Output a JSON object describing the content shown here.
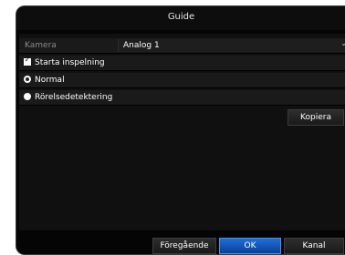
{
  "window": {
    "title": "Guide"
  },
  "form": {
    "camera_label": "Kamera",
    "camera_value": "Analog 1",
    "start_recording_label": "Starta inspelning",
    "start_recording_checked": true,
    "mode_options": [
      "Normal",
      "Rörelsedetektering"
    ],
    "mode_selected": "Normal",
    "copy_label": "Kopiera"
  },
  "footer": {
    "previous_label": "Föregående",
    "ok_label": "OK",
    "channel_label": "Kanal"
  },
  "colors": {
    "background": "#050505",
    "row": "#1a1a1a",
    "accent_blue": "#1f6fd6"
  }
}
